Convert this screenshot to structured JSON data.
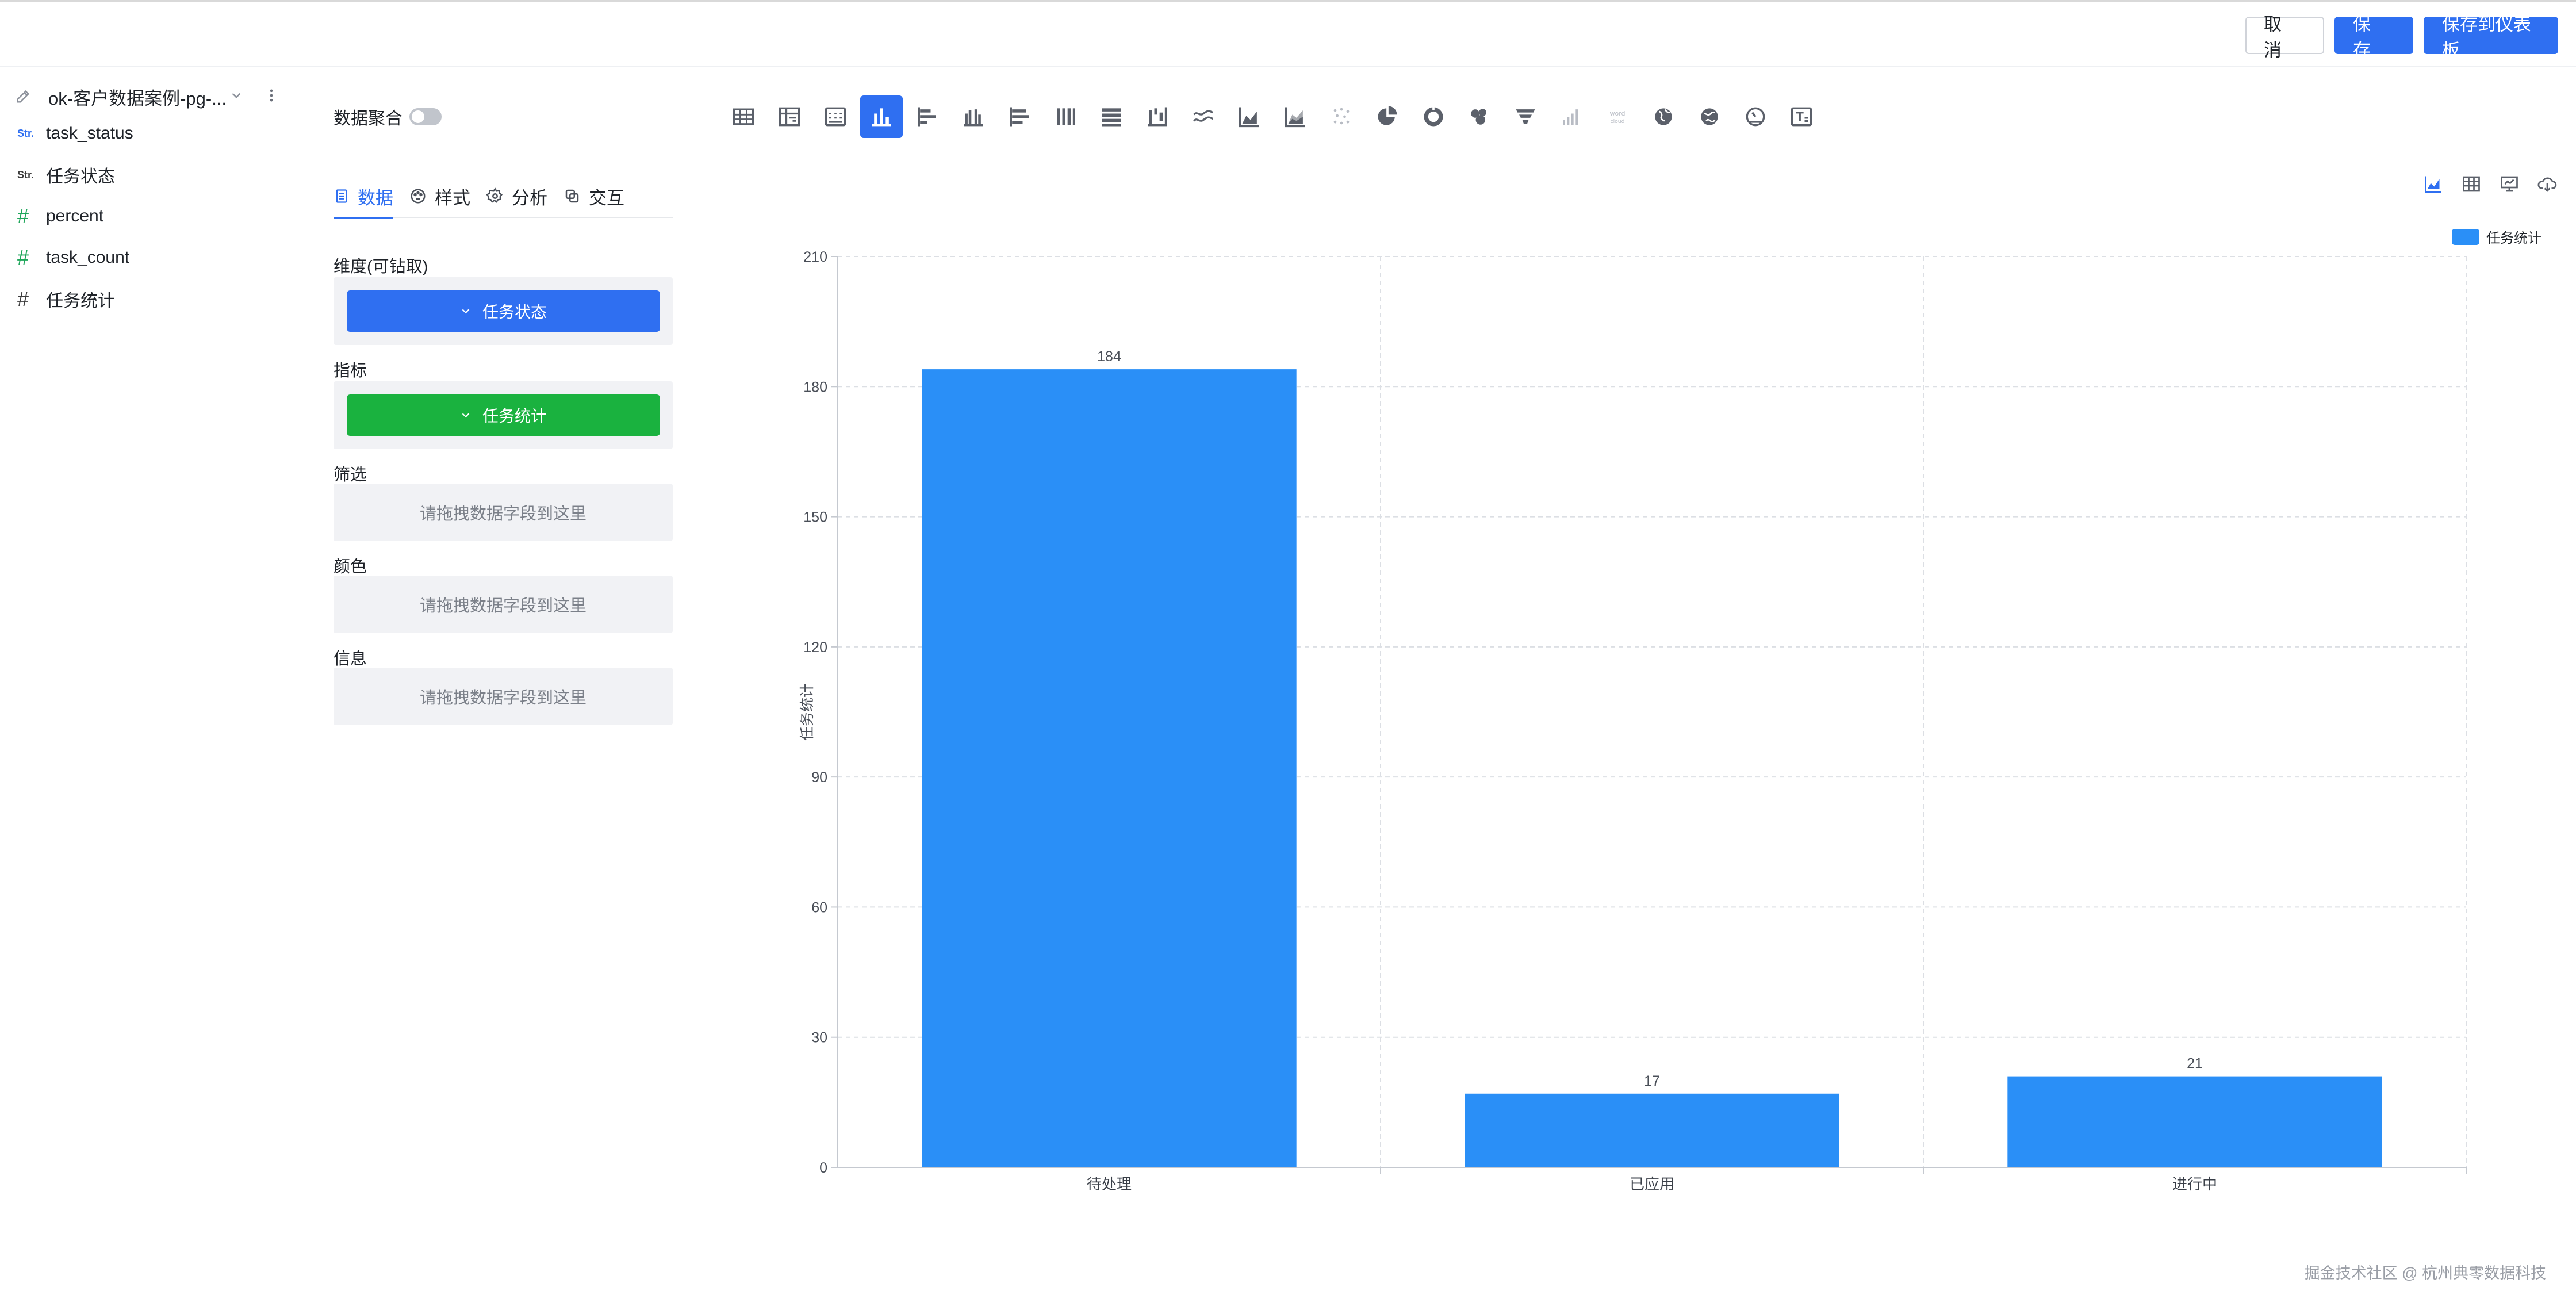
{
  "header": {
    "cancel_label": "取 消",
    "save_label": "保 存",
    "save_dashboard_label": "保存到仪表板"
  },
  "sidebar": {
    "dataset_name": "ok-客户数据案例-pg-...",
    "fields": [
      {
        "type_label": "Str.",
        "name": "task_status"
      },
      {
        "type_label": "Str.",
        "name": "任务状态"
      },
      {
        "type_label": "#",
        "name": "percent"
      },
      {
        "type_label": "#",
        "name": "task_count"
      },
      {
        "type_label": "#",
        "name": "任务统计"
      }
    ]
  },
  "config": {
    "aggregate_label": "数据聚合",
    "aggregate_on": false,
    "tabs": [
      {
        "label": "数据",
        "icon": "data-icon",
        "active": true
      },
      {
        "label": "样式",
        "icon": "palette-icon",
        "active": false
      },
      {
        "label": "分析",
        "icon": "gear-icon",
        "active": false
      },
      {
        "label": "交互",
        "icon": "link-icon",
        "active": false
      }
    ],
    "dimension_label": "维度(可钻取)",
    "dimension_field": "任务状态",
    "metric_label": "指标",
    "metric_field": "任务统计",
    "filter_label": "筛选",
    "color_label": "颜色",
    "info_label": "信息",
    "drop_placeholder": "请拖拽数据字段到这里"
  },
  "chart_types": [
    "table-icon",
    "pivot-table-icon",
    "cross-table-icon",
    "column-chart-icon",
    "bar-chart-icon",
    "grouped-column-icon",
    "stacked-bar-icon",
    "stacked-column-icon",
    "percent-bar-icon",
    "waterfall-icon",
    "line-chart-icon",
    "area-chart-icon",
    "stacked-area-icon",
    "scatter-icon",
    "pie-chart-icon",
    "donut-chart-icon",
    "treemap-icon",
    "funnel-icon",
    "sankey-icon",
    "word-cloud-icon",
    "map-icon",
    "globe-icon",
    "gauge-icon",
    "text-card-icon"
  ],
  "active_chart_type_index": 3,
  "chart_data": {
    "type": "bar",
    "categories": [
      "待处理",
      "已应用",
      "进行中"
    ],
    "series": [
      {
        "name": "任务统计",
        "values": [
          184,
          17,
          21
        ]
      }
    ],
    "ylabel": "任务统计",
    "xlabel": "",
    "ylim": [
      0,
      210
    ],
    "yticks": [
      0,
      30,
      60,
      90,
      120,
      150,
      180,
      210
    ],
    "grid": true,
    "legend": "top-right",
    "bar_color": "#2a8ff7"
  },
  "footer": {
    "watermark": "掘金技术社区 @ 杭州典零数据科技"
  },
  "colors": {
    "primary": "#2f6ff1",
    "metric_green": "#1ab23f",
    "bar": "#2a8ff7"
  }
}
